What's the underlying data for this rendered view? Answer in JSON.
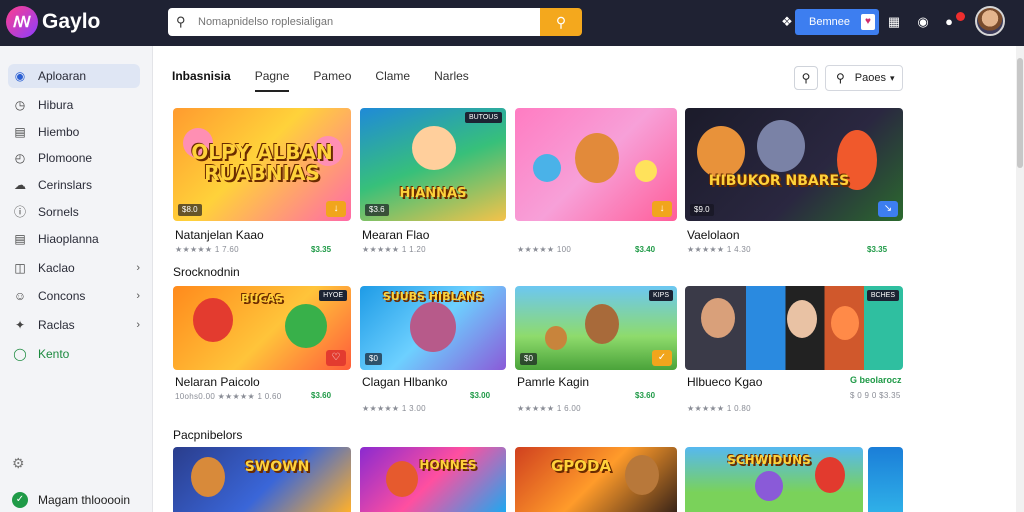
{
  "header": {
    "brand": "Gaylo",
    "logo_glyph": "ꟿ",
    "search_placeholder": "Nomapnidelso roplesialigan",
    "signin_label": "Bemnee",
    "signin_mini": "♥",
    "icons": [
      "search-icon",
      "grid-icon",
      "globe-icon",
      "notification-icon"
    ]
  },
  "sidebar": {
    "items": [
      {
        "label": "Aploaran",
        "icon": "compass-icon"
      },
      {
        "label": "Hibura",
        "icon": "clock-icon"
      },
      {
        "label": "Hiembo",
        "icon": "document-icon"
      },
      {
        "label": "Plomoone",
        "icon": "timer-icon"
      },
      {
        "label": "Cerinslars",
        "icon": "cloud-icon"
      },
      {
        "label": "Sornels",
        "icon": "info-icon"
      },
      {
        "label": "Hiaoplanna",
        "icon": "list-icon"
      },
      {
        "label": "Kaclao",
        "icon": "book-icon"
      },
      {
        "label": "Concons",
        "icon": "user-icon"
      },
      {
        "label": "Raclas",
        "icon": "star-icon"
      },
      {
        "label": "Kento",
        "icon": "headset-icon"
      }
    ],
    "footer_label": "Magam thlooooin"
  },
  "tabs": [
    "Inbasnisia",
    "Pagne",
    "Pameo",
    "Clame",
    "Narles"
  ],
  "filter_label": "Paoes",
  "sections": [
    {
      "title": ""
    },
    {
      "title": "Srocknodnin"
    },
    {
      "title": "Pacpnibelors"
    }
  ],
  "cards": [
    {
      "art": "OLPY ALBAN RUABNIAS",
      "chip": "$8.0",
      "title": "Natanjelan Kaao",
      "meta": "★★★★★ 1 7.60",
      "price": "$3.35",
      "corner": "↓"
    },
    {
      "art": "HIANNAS",
      "chip": "$3.6",
      "title": "Mearan Flao",
      "meta": "★★★★★ 1 1.20",
      "price": "$3.35",
      "corner": "",
      "badge": "BUTOUS"
    },
    {
      "art": "",
      "chip": "",
      "title": "",
      "meta": "★★★★★ 100",
      "price": "$3.40",
      "corner": "↓"
    },
    {
      "art": "HIBUKOR NBARES",
      "chip": "$9.0",
      "title": "Vaelolaon",
      "meta": "★★★★★ 1 4.30",
      "price": "$3.35",
      "corner": "↘"
    },
    {
      "art": "BUCAS",
      "chip": "",
      "title": "Nelaran Paicolo",
      "meta": "10ohs0.00 ★★★★★ 1 0.60",
      "price": "$3.60",
      "corner": "♡",
      "badge": "HYOE"
    },
    {
      "art": "SUUBS HIBLANS",
      "chip": "$0",
      "title": "Clagan Hlbanko",
      "meta": "★★★★★ 1 3.00",
      "price": "$3.00",
      "corner": ""
    },
    {
      "art": "",
      "chip": "$0",
      "title": "Pamrle Kagin",
      "meta": "★★★★★ 1 6.00",
      "price": "$3.60",
      "corner": "✓",
      "badge": "KIPS"
    },
    {
      "art": "",
      "chip": "",
      "title": "Hlbueco Kgao",
      "meta": "★★★★★ 1 0.80",
      "price": "G beolarocz",
      "price2": "$ 0 9 0 $3.35",
      "corner": "",
      "badge": "BCHES"
    },
    {
      "art": "SWOWN",
      "chip": "",
      "title": "",
      "meta": "",
      "price": "",
      "corner": ""
    },
    {
      "art": "HONNES",
      "chip": "",
      "title": "",
      "meta": "",
      "price": "",
      "corner": ""
    },
    {
      "art": "GPODA",
      "chip": "",
      "title": "",
      "meta": "",
      "price": "",
      "corner": ""
    },
    {
      "art": "SCHWIDUNS",
      "chip": "",
      "title": "",
      "meta": "",
      "price": "",
      "corner": ""
    }
  ]
}
